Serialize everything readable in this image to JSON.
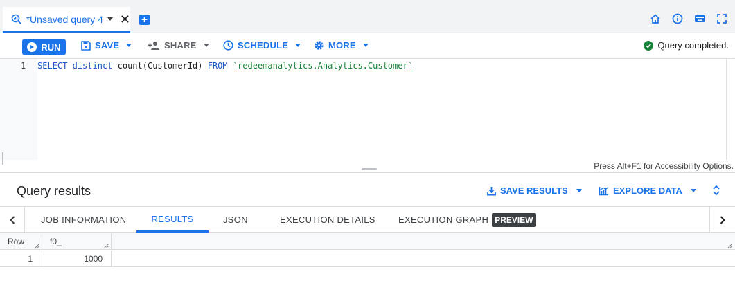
{
  "tab": {
    "title": "*Unsaved query 4",
    "icon": "query-icon",
    "close_glyph": "✕",
    "add_icon": "add-tab-icon",
    "add_glyph": "+"
  },
  "header_icons": [
    "home-icon",
    "info-icon",
    "keyboard-icon",
    "fullscreen-icon"
  ],
  "toolbar": {
    "run_label": "RUN",
    "save_label": "SAVE",
    "share_label": "SHARE",
    "schedule_label": "SCHEDULE",
    "more_label": "MORE",
    "status_text": "Query completed."
  },
  "editor": {
    "line_number": "1",
    "kw_select": "SELECT",
    "kw_distinct": "distinct",
    "fn_count": "count(CustomerId)",
    "kw_from": "FROM",
    "table_ref": "`redeemanalytics.Analytics.Customer`",
    "accessibility_hint": "Press Alt+F1 for Accessibility Options."
  },
  "results": {
    "title": "Query results",
    "save_results_label": "SAVE RESULTS",
    "explore_data_label": "EXPLORE DATA",
    "tabs": [
      {
        "label": "JOB INFORMATION"
      },
      {
        "label": "RESULTS"
      },
      {
        "label": "JSON"
      },
      {
        "label": "EXECUTION DETAILS"
      },
      {
        "label": "EXECUTION GRAPH"
      }
    ],
    "preview_badge": "PREVIEW",
    "active_tab": "RESULTS",
    "table": {
      "columns": [
        "Row",
        "f0_"
      ],
      "rows": [
        {
          "row": "1",
          "f0_": "1000"
        }
      ]
    }
  },
  "colors": {
    "accent": "#1a73e8",
    "success": "#188038",
    "text": "#3c4043"
  }
}
